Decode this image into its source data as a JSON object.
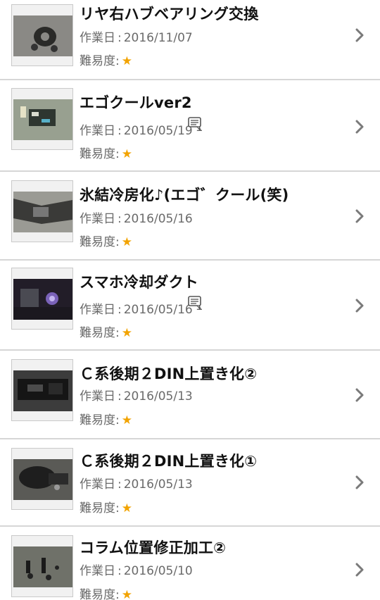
{
  "items": [
    {
      "title": "リヤ右ハブベアリング交換",
      "date_label": "作業日",
      "date": "2016/11/07",
      "comments": "",
      "difficulty_label": "難易度",
      "difficulty_stars": "★",
      "thumb_bg": "#5b5b56",
      "thumb_fg": "#2a2a28"
    },
    {
      "title": "エゴクールver2",
      "date_label": "作業日",
      "date": "2016/05/19",
      "comments": "1",
      "difficulty_label": "難易度",
      "difficulty_stars": "★",
      "thumb_bg": "#7f8a78",
      "thumb_fg": "#333b34"
    },
    {
      "title": "氷結冷房化♪(エゴ゛クール(笑)",
      "date_label": "作業日",
      "date": "2016/05/16",
      "comments": "",
      "difficulty_label": "難易度",
      "difficulty_stars": "★",
      "thumb_bg": "#8a8a86",
      "thumb_fg": "#2e2e2c"
    },
    {
      "title": "スマホ冷却ダクト",
      "date_label": "作業日",
      "date": "2016/05/16",
      "comments": "1",
      "difficulty_label": "難易度",
      "difficulty_stars": "★",
      "thumb_bg": "#2b2530",
      "thumb_fg": "#6f5aa6"
    },
    {
      "title": "Ｃ系後期２DIN上置き化②",
      "date_label": "作業日",
      "date": "2016/05/13",
      "comments": "",
      "difficulty_label": "難易度",
      "difficulty_stars": "★",
      "thumb_bg": "#3a3a3a",
      "thumb_fg": "#1a1a1a"
    },
    {
      "title": "Ｃ系後期２DIN上置き化①",
      "date_label": "作業日",
      "date": "2016/05/13",
      "comments": "",
      "difficulty_label": "難易度",
      "difficulty_stars": "★",
      "thumb_bg": "#4a4a48",
      "thumb_fg": "#1f1f1f"
    },
    {
      "title": "コラム位置修正加工②",
      "date_label": "作業日",
      "date": "2016/05/10",
      "comments": "",
      "difficulty_label": "難易度",
      "difficulty_stars": "★",
      "thumb_bg": "#5d5f57",
      "thumb_fg": "#202020"
    }
  ],
  "colors": {
    "star": "#f2a300",
    "meta_text": "#6a6a6a",
    "divider": "#d6d6d6"
  },
  "icons": {
    "comment": "speech-bubble-icon",
    "chevron": "chevron-right-icon"
  }
}
